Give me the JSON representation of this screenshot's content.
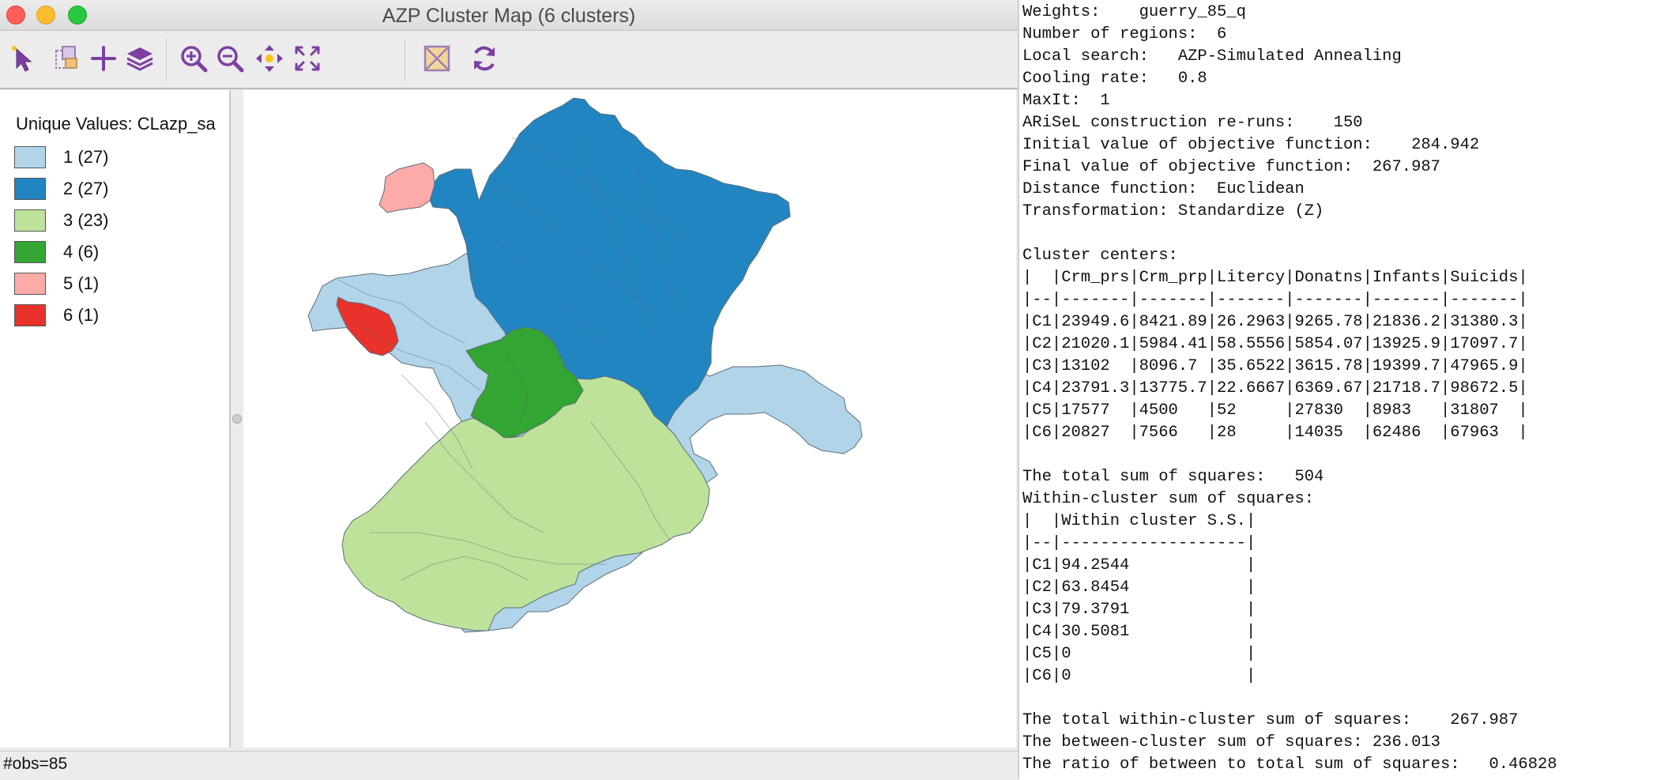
{
  "window": {
    "title": "AZP Cluster Map (6 clusters)"
  },
  "toolbar": {
    "tools": [
      {
        "name": "select-tool",
        "icon": "pointer-icon"
      },
      {
        "name": "selection-shape-tool",
        "icon": "selection-shape-icon"
      },
      {
        "name": "add-tool",
        "icon": "plus-icon"
      },
      {
        "name": "layers-tool",
        "icon": "layers-icon"
      },
      {
        "name": "zoom-in-tool",
        "icon": "zoom-in-icon"
      },
      {
        "name": "zoom-out-tool",
        "icon": "zoom-out-icon"
      },
      {
        "name": "pan-tool",
        "icon": "pan-icon"
      },
      {
        "name": "fit-extent-tool",
        "icon": "fit-extent-icon"
      },
      {
        "name": "basemap-tool",
        "icon": "basemap-icon"
      },
      {
        "name": "refresh-tool",
        "icon": "refresh-icon"
      }
    ]
  },
  "legend": {
    "title": "Unique Values: CLazp_sa",
    "items": [
      {
        "label": "1 (27)",
        "color": "#b2d4e8"
      },
      {
        "label": "2 (27)",
        "color": "#2185c1"
      },
      {
        "label": "3 (23)",
        "color": "#bfe29a"
      },
      {
        "label": "4 (6)",
        "color": "#33a532"
      },
      {
        "label": "5 (1)",
        "color": "#fcaba8"
      },
      {
        "label": "6 (1)",
        "color": "#e8322b"
      }
    ]
  },
  "status": {
    "text": "#obs=85"
  },
  "report": {
    "lines": [
      "Weights:    guerry_85_q",
      "Number of regions:  6",
      "Local search:   AZP-Simulated Annealing",
      "Cooling rate:   0.8",
      "MaxIt:  1",
      "ARiSeL construction re-runs:    150",
      "Initial value of objective function:    284.942",
      "Final value of objective function:  267.987",
      "Distance function:  Euclidean",
      "Transformation: Standardize (Z)",
      "",
      "Cluster centers:",
      "|  |Crm_prs|Crm_prp|Litercy|Donatns|Infants|Suicids|",
      "|--|-------|-------|-------|-------|-------|-------|",
      "|C1|23949.6|8421.89|26.2963|9265.78|21836.2|31380.3|",
      "|C2|21020.1|5984.41|58.5556|5854.07|13925.9|17097.7|",
      "|C3|13102  |8096.7 |35.6522|3615.78|19399.7|47965.9|",
      "|C4|23791.3|13775.7|22.6667|6369.67|21718.7|98672.5|",
      "|C5|17577  |4500   |52     |27830  |8983   |31807  |",
      "|C6|20827  |7566   |28     |14035  |62486  |67963  |",
      "",
      "The total sum of squares:   504",
      "Within-cluster sum of squares:",
      "|  |Within cluster S.S.|",
      "|--|-------------------|",
      "|C1|94.2544            |",
      "|C2|63.8454            |",
      "|C3|79.3791            |",
      "|C4|30.5081            |",
      "|C5|0                  |",
      "|C6|0                  |",
      "",
      "The total within-cluster sum of squares:    267.987",
      "The between-cluster sum of squares: 236.013",
      "The ratio of between to total sum of squares:   0.46828"
    ]
  },
  "colors": {
    "accent": "#7d3fa3"
  }
}
